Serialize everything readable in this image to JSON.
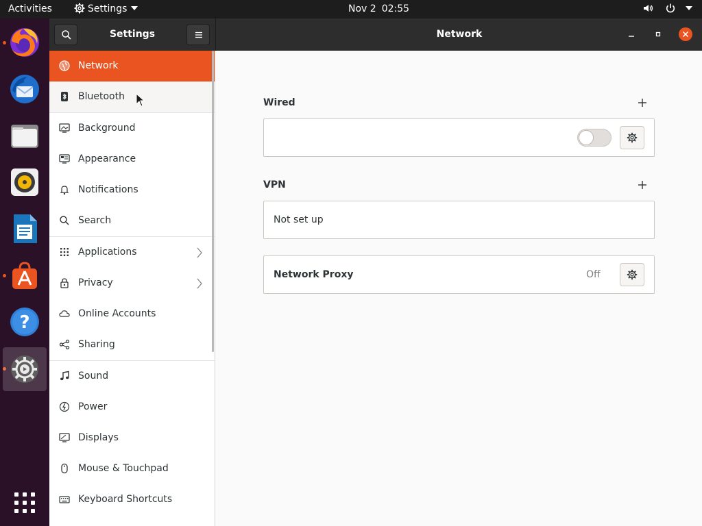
{
  "topbar": {
    "activities": "Activities",
    "app_menu": "Settings",
    "date": "Nov 2",
    "time": "02:55"
  },
  "dock": [
    {
      "name": "Firefox Web Browser",
      "icon": "firefox-icon",
      "running": true
    },
    {
      "name": "Thunderbird Mail",
      "icon": "thunderbird-icon",
      "running": false
    },
    {
      "name": "Files",
      "icon": "files-icon",
      "running": false
    },
    {
      "name": "Rhythmbox",
      "icon": "rhythmbox-icon",
      "running": false
    },
    {
      "name": "LibreOffice Writer",
      "icon": "writer-icon",
      "running": false
    },
    {
      "name": "Ubuntu Software",
      "icon": "software-icon",
      "running": true
    },
    {
      "name": "Help",
      "icon": "help-icon",
      "running": false
    },
    {
      "name": "Settings",
      "icon": "settings-icon",
      "running": true,
      "active": true
    },
    {
      "name": "Show Applications",
      "icon": "app-grid-icon"
    }
  ],
  "window": {
    "sidebar_title": "Settings",
    "page_title": "Network"
  },
  "sidebar": {
    "items": [
      {
        "label": "Network",
        "icon": "network-icon",
        "selected": true
      },
      {
        "label": "Bluetooth",
        "icon": "bluetooth-icon",
        "hover": true
      },
      {
        "label": "Background",
        "icon": "background-icon"
      },
      {
        "label": "Appearance",
        "icon": "appearance-icon"
      },
      {
        "label": "Notifications",
        "icon": "bell-icon"
      },
      {
        "label": "Search",
        "icon": "search-icon"
      },
      {
        "label": "Applications",
        "icon": "applications-icon",
        "has_submenu": true
      },
      {
        "label": "Privacy",
        "icon": "lock-icon",
        "has_submenu": true
      },
      {
        "label": "Online Accounts",
        "icon": "cloud-icon"
      },
      {
        "label": "Sharing",
        "icon": "share-icon"
      },
      {
        "label": "Sound",
        "icon": "music-note-icon"
      },
      {
        "label": "Power",
        "icon": "power-icon"
      },
      {
        "label": "Displays",
        "icon": "display-icon"
      },
      {
        "label": "Mouse & Touchpad",
        "icon": "mouse-icon"
      },
      {
        "label": "Keyboard Shortcuts",
        "icon": "keyboard-icon"
      }
    ]
  },
  "network": {
    "wired": {
      "title": "Wired",
      "enabled": false
    },
    "vpn": {
      "title": "VPN",
      "status_text": "Not set up"
    },
    "proxy": {
      "label": "Network Proxy",
      "status": "Off"
    }
  },
  "colors": {
    "accent": "#e95420",
    "topbar_bg": "#1d1d1d",
    "dock_bg": "#2b1128",
    "headerbar_bg": "#2d2d2d"
  }
}
